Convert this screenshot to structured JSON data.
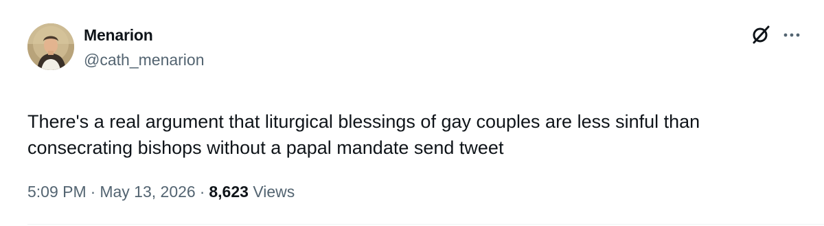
{
  "author": {
    "display_name": "Menarion",
    "handle": "@cath_menarion",
    "avatar_icon": "avatar-portrait"
  },
  "actions": {
    "grok_icon": "grok-icon",
    "more_icon": "more-icon"
  },
  "tweet": {
    "text": "There's a real argument that liturgical blessings of gay couples are less sinful than consecrating bishops without a papal mandate send tweet"
  },
  "meta": {
    "time": "5:09 PM",
    "separator": "·",
    "date": "May 13, 2026",
    "views_count": "8,623",
    "views_label": "Views"
  },
  "colors": {
    "text_primary": "#0f1419",
    "text_secondary": "#536471",
    "divider": "#eff3f4"
  }
}
